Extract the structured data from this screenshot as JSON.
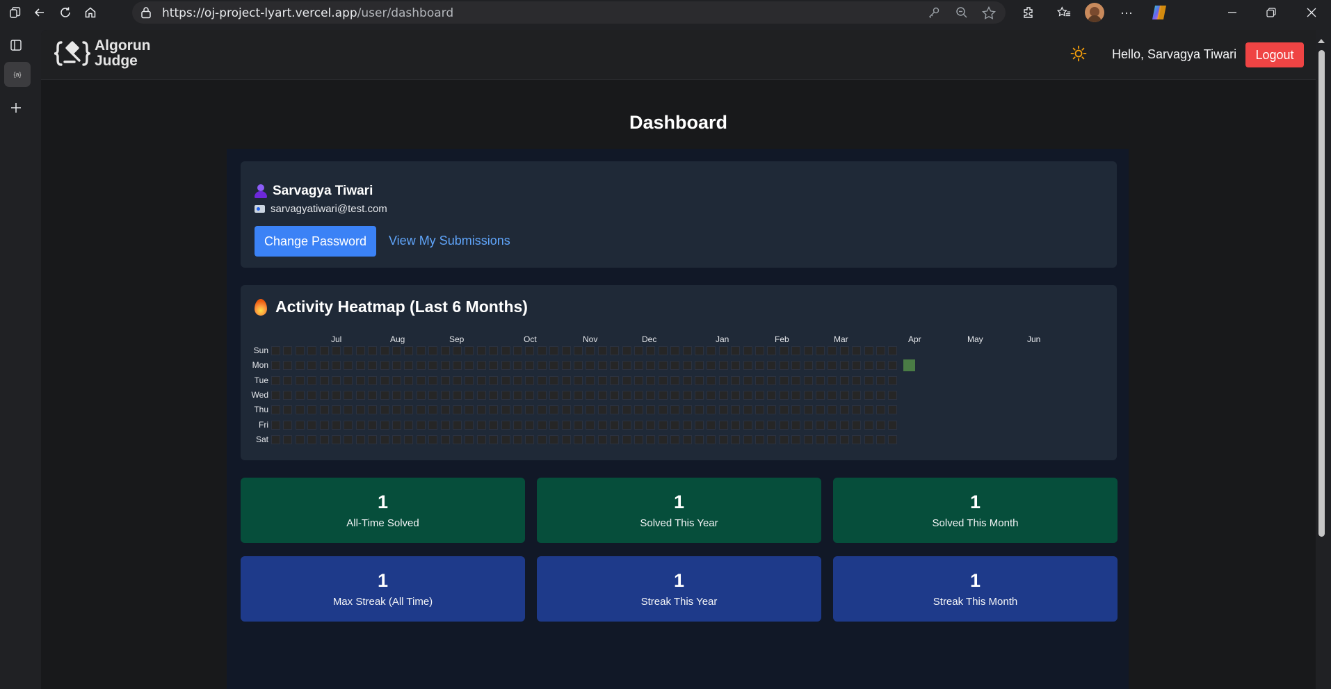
{
  "browser": {
    "url_host": "https://oj-project-lyart.vercel.app",
    "url_path": "/user/dashboard",
    "tab_favicon_text": "{a}"
  },
  "app": {
    "logo_line1": "Algorun",
    "logo_line2": "Judge",
    "greeting": "Hello, Sarvagya Tiwari",
    "logout_label": "Logout",
    "theme_icon": "sun-icon"
  },
  "page": {
    "title": "Dashboard"
  },
  "profile": {
    "name": "Sarvagya Tiwari",
    "email": "sarvagyatiwari@test.com",
    "change_password_label": "Change Password",
    "view_submissions_label": "View My Submissions"
  },
  "heatmap": {
    "title": "Activity Heatmap (Last 6 Months)",
    "months": [
      "Jul",
      "Aug",
      "Sep",
      "Oct",
      "Nov",
      "Dec",
      "Jan",
      "Feb",
      "Mar",
      "Apr",
      "May",
      "Jun"
    ],
    "days": [
      "Sun",
      "Mon",
      "Tue",
      "Wed",
      "Thu",
      "Fri",
      "Sat"
    ],
    "active_days": [
      {
        "week": 52,
        "day": "Mon",
        "count": 1
      }
    ]
  },
  "stats": [
    {
      "value": "1",
      "label": "All-Time Solved",
      "color": "#064e3b"
    },
    {
      "value": "1",
      "label": "Solved This Year",
      "color": "#064e3b"
    },
    {
      "value": "1",
      "label": "Solved This Month",
      "color": "#064e3b"
    },
    {
      "value": "1",
      "label": "Max Streak (All Time)",
      "color": "#1e3a8a"
    },
    {
      "value": "1",
      "label": "Streak This Year",
      "color": "#1e3a8a"
    },
    {
      "value": "1",
      "label": "Streak This Month",
      "color": "#1e3a8a"
    }
  ]
}
